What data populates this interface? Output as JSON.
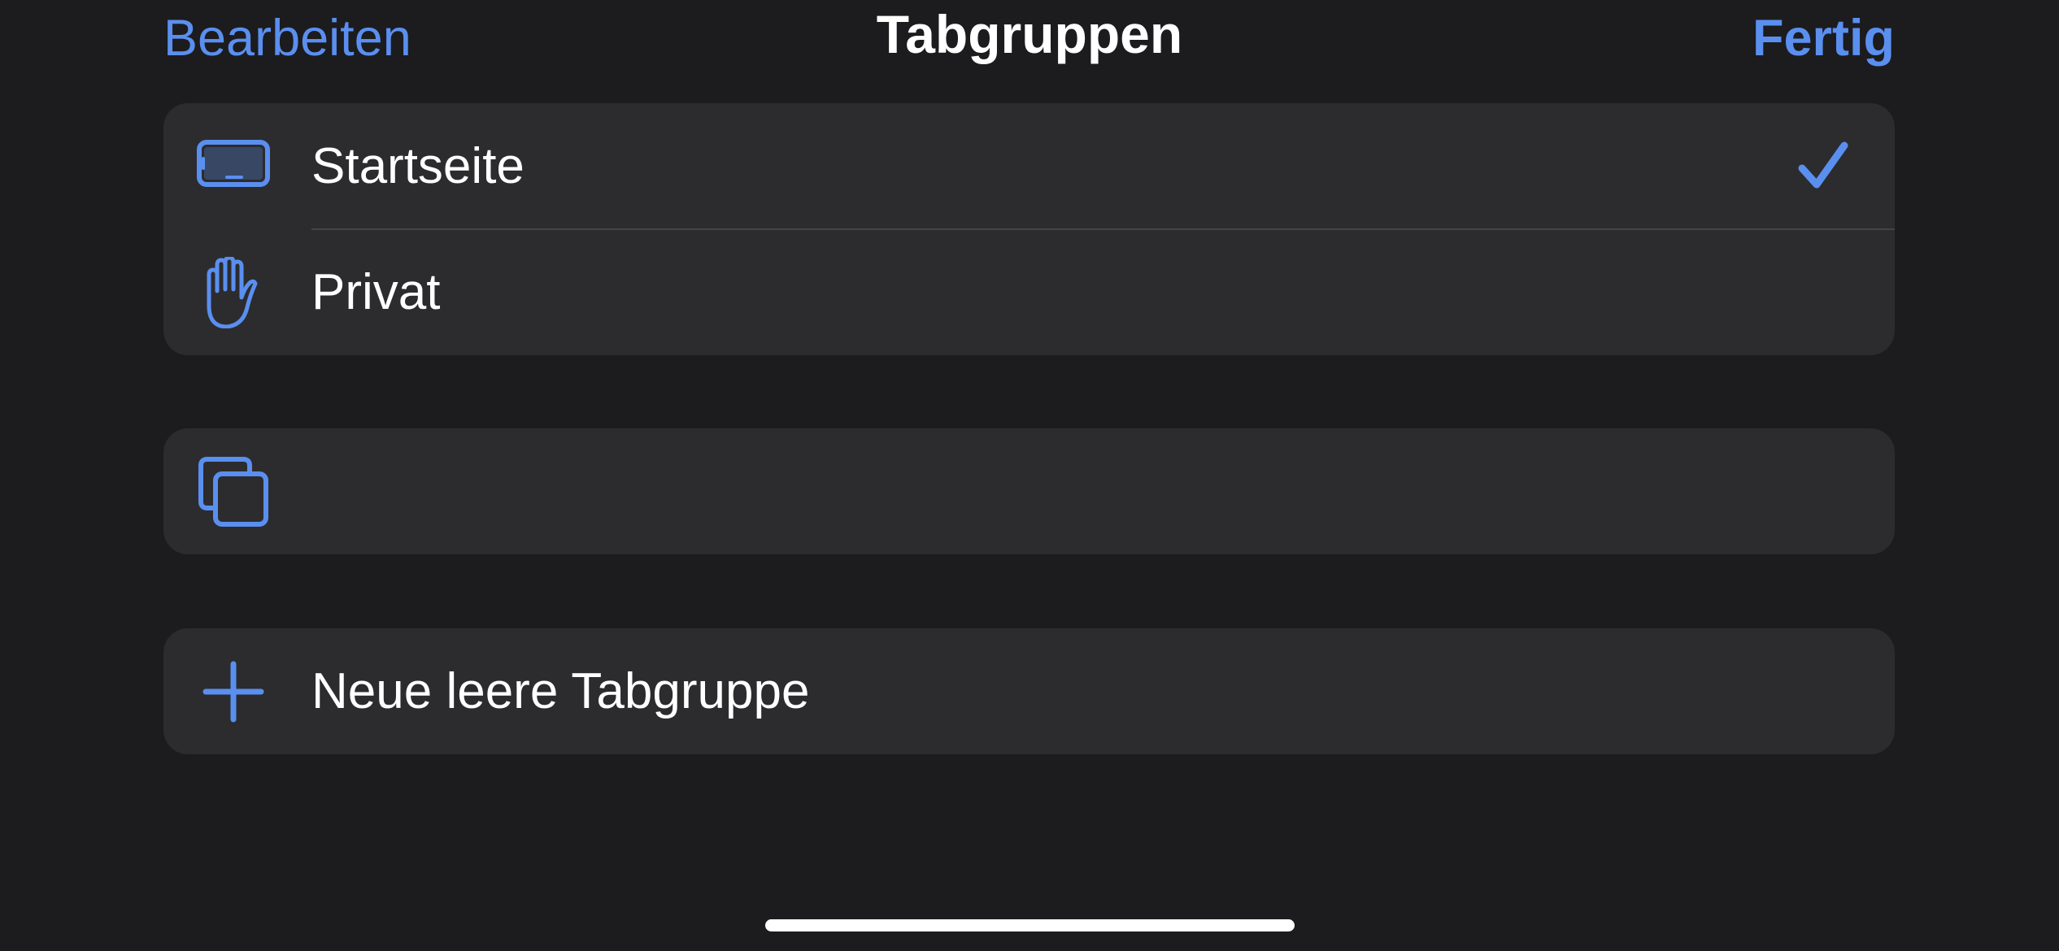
{
  "navbar": {
    "edit_label": "Bearbeiten",
    "title": "Tabgruppen",
    "done_label": "Fertig"
  },
  "tab_groups": [
    {
      "label": "Startseite",
      "icon": "tablet-icon",
      "selected": true
    },
    {
      "label": "Privat",
      "icon": "hand-raised-icon",
      "selected": false
    }
  ],
  "shared_row": {
    "label": "",
    "icon": "square-on-square-icon"
  },
  "new_group": {
    "label": "Neue leere Tabgruppe",
    "icon": "plus-icon"
  },
  "colors": {
    "background": "#1c1c1e",
    "cell": "#2c2c2e",
    "accent": "#5a8ff0",
    "text": "#ffffff",
    "separator": "#444446"
  }
}
